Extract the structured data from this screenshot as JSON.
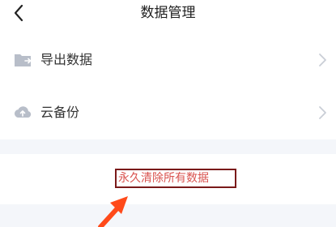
{
  "header": {
    "title": "数据管理",
    "back_icon": "chevron-left-icon"
  },
  "list": {
    "items": [
      {
        "label": "导出数据",
        "icon": "folder-export-icon"
      },
      {
        "label": "云备份",
        "icon": "cloud-upload-icon"
      }
    ]
  },
  "danger": {
    "clear_all_label": "永久清除所有数据",
    "color": "#d9534f",
    "highlight_border": "#7a1a1a"
  },
  "annotation": {
    "arrow_color": "#ff4a1a",
    "icon": "pointer-arrow-icon"
  }
}
